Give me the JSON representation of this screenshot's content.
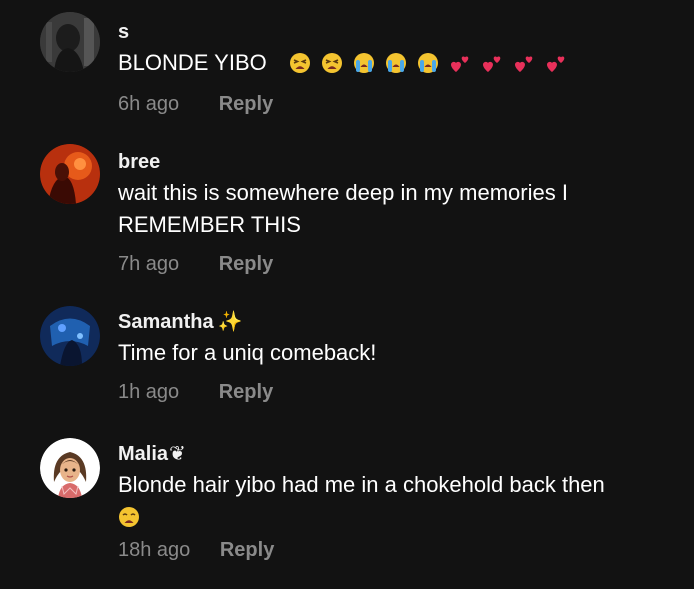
{
  "comments": [
    {
      "username": "s",
      "username_decoration": "",
      "text": "BLONDE YIBO",
      "emojis": [
        "tired-face",
        "tired-face",
        "loudly-crying-face",
        "loudly-crying-face",
        "loudly-crying-face",
        "two-hearts",
        "two-hearts",
        "two-hearts",
        "two-hearts"
      ],
      "time": "6h ago",
      "reply_label": "Reply"
    },
    {
      "username": "bree",
      "username_decoration": "",
      "text": "wait this is somewhere deep in my memories I REMEMBER THIS",
      "emojis": [],
      "time": "7h ago",
      "reply_label": "Reply"
    },
    {
      "username": "Samantha",
      "username_decoration": "✨",
      "text": "Time for a uniq comeback!",
      "emojis": [],
      "time": "1h ago",
      "reply_label": "Reply"
    },
    {
      "username": "Malia",
      "username_decoration": "❦",
      "text": "Blonde hair yibo had me in a chokehold back then",
      "emojis": [
        "weary-face"
      ],
      "time": "18h ago",
      "reply_label": "Reply"
    }
  ],
  "colors": {
    "background": "#121212",
    "text": "#ffffff",
    "muted": "#8a8a8a",
    "emoji_yellow": "#f4c430",
    "emoji_pink": "#e8305a"
  }
}
